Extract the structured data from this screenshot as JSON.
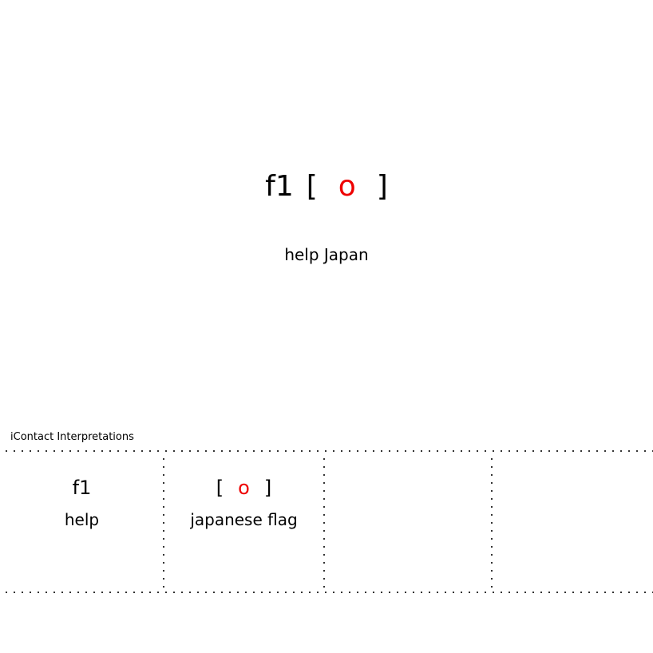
{
  "message": {
    "glyphs": [
      {
        "text": "f1",
        "color": "#000000"
      },
      {
        "text": "[",
        "color": "#000000"
      },
      {
        "text": "o",
        "color": "#ee0000"
      },
      {
        "text": "]",
        "color": "#000000"
      }
    ],
    "meaning": "help Japan"
  },
  "interpretations": {
    "label": "iContact Interpretations",
    "cells": [
      {
        "glyph": "f1",
        "meaning": "help"
      },
      {
        "glyph_open": "[",
        "glyph_mid": "o",
        "glyph_close": "]",
        "meaning": "japanese flag",
        "accent": "#ee0000"
      },
      {
        "glyph": "",
        "meaning": ""
      },
      {
        "glyph": "",
        "meaning": ""
      }
    ]
  }
}
